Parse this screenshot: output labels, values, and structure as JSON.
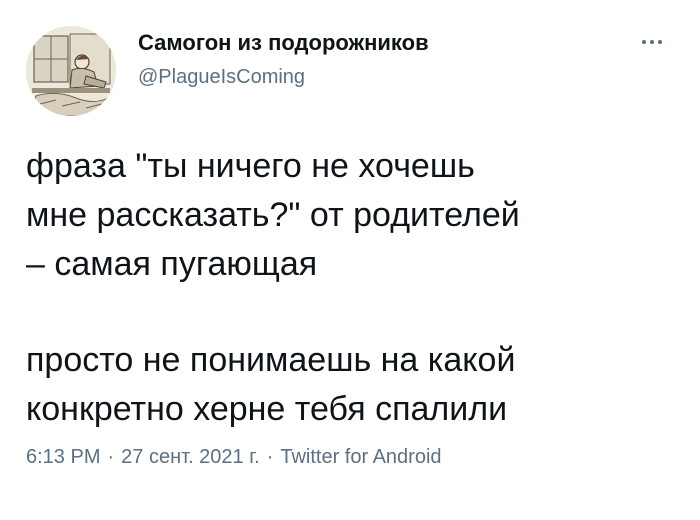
{
  "author": {
    "display_name": "Самогон из подорожников",
    "handle": "@PlagueIsComing",
    "avatar_icon": "profile-illustration-avatar"
  },
  "menu": {
    "more_icon": "more-horizontal-icon"
  },
  "tweet": {
    "paragraph_1": [
      "фраза \"ты ничего не хочешь",
      "мне рассказать?\" от родителей",
      "– самая пугающая"
    ],
    "paragraph_2": [
      "просто не понимаешь на какой",
      "конкретно херне тебя спалили"
    ]
  },
  "meta": {
    "time": "6:13 PM",
    "date": "27 сент. 2021 г.",
    "separator": "·",
    "source": "Twitter for Android"
  },
  "colors": {
    "text": "#0f1419",
    "secondary": "#5b7083",
    "background": "#ffffff"
  }
}
